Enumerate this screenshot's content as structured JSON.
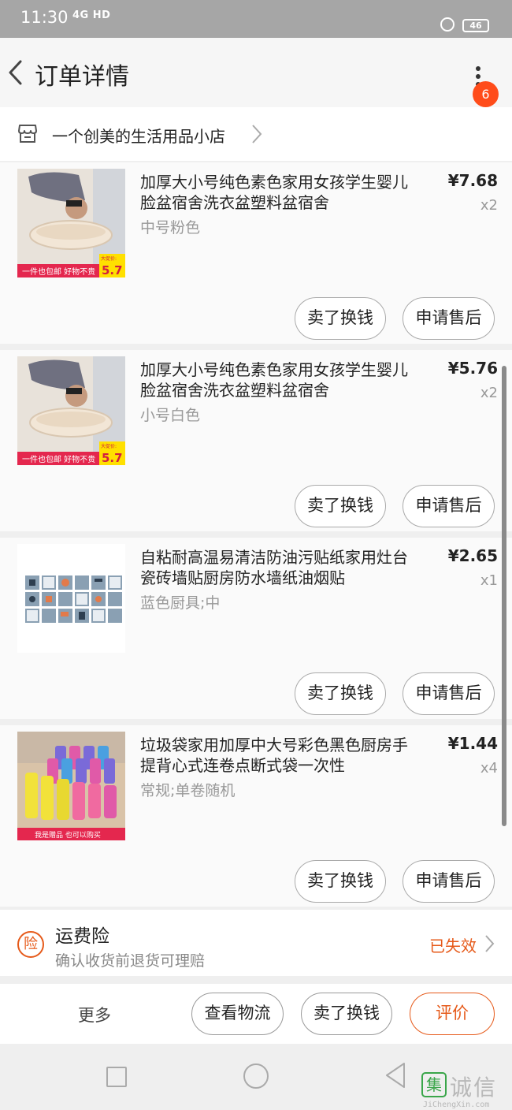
{
  "status_bar": {
    "time": "11:30",
    "network": "4G HD",
    "battery": "46"
  },
  "header": {
    "title": "订单详情",
    "badge_count": "6",
    "back_icon": "back-chevron-icon",
    "more_icon": "more-vertical-icon"
  },
  "shop": {
    "name": "一个创美的生活用品小店",
    "icon": "store-icon"
  },
  "items": [
    {
      "name": "加厚大小号纯色素色家用女孩学生婴儿脸盆宿舍洗衣盆塑料盆宿舍",
      "spec": "中号粉色",
      "price": "¥7.68",
      "qty": "x2",
      "thumb_banner": "一件也包邮  好物不贵",
      "thumb_tag_small": "大促价:",
      "thumb_tag": "5.7",
      "btn_swap": "卖了换钱",
      "btn_after_sale": "申请售后"
    },
    {
      "name": "加厚大小号纯色素色家用女孩学生婴儿脸盆宿舍洗衣盆塑料盆宿舍",
      "spec": "小号白色",
      "price": "¥5.76",
      "qty": "x2",
      "thumb_banner": "一件也包邮  好物不贵",
      "thumb_tag_small": "大促价:",
      "thumb_tag": "5.7",
      "btn_swap": "卖了换钱",
      "btn_after_sale": "申请售后"
    },
    {
      "name": "自粘耐高温易清洁防油污贴纸家用灶台瓷砖墙贴厨房防水墙纸油烟贴",
      "spec": "蓝色厨具;中",
      "price": "¥2.65",
      "qty": "x1",
      "btn_swap": "卖了换钱",
      "btn_after_sale": "申请售后"
    },
    {
      "name": "垃圾袋家用加厚中大号彩色黑色厨房手提背心式连卷点断式袋一次性",
      "spec": "常规;单卷随机",
      "price": "¥1.44",
      "qty": "x4",
      "thumb_banner": "我是赠品  也可以购买",
      "btn_swap": "卖了换钱",
      "btn_after_sale": "申请售后"
    }
  ],
  "insurance": {
    "icon_label": "险",
    "title": "运费险",
    "subtitle": "确认收货前退货可理赔",
    "status": "已失效"
  },
  "bottom_bar": {
    "more": "更多",
    "logistics": "查看物流",
    "swap": "卖了换钱",
    "review": "评价"
  },
  "watermark": {
    "logo": "集",
    "text": "诚信",
    "url": "JiChengXin.com"
  },
  "colors": {
    "accent": "#e65a1a",
    "badge": "#ff4c1a",
    "status_bar": "#a6a6a6"
  }
}
